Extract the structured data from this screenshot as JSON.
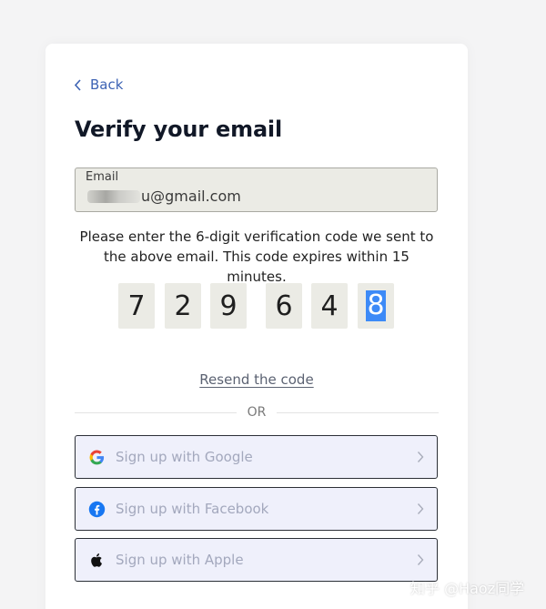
{
  "nav": {
    "back_label": "Back"
  },
  "page": {
    "title": "Verify your email"
  },
  "email": {
    "label": "Email",
    "value_suffix": "u@gmail.com"
  },
  "instructions": "Please enter the 6-digit verification code we sent to the above email. This code expires within 15 minutes.",
  "code": {
    "digits": [
      "7",
      "2",
      "9",
      "6",
      "4",
      "8"
    ],
    "selected_index": 5
  },
  "resend_label": "Resend the code",
  "divider_label": "OR",
  "social": {
    "google_label": "Sign up with Google",
    "facebook_label": "Sign up with Facebook",
    "apple_label": "Sign up with Apple"
  },
  "watermark": "知乎 @Haoz同学",
  "colors": {
    "accent": "#3d63b4",
    "selection": "#3d8af7",
    "field_bg": "#ebebe5",
    "social_bg": "#eff0fb"
  }
}
